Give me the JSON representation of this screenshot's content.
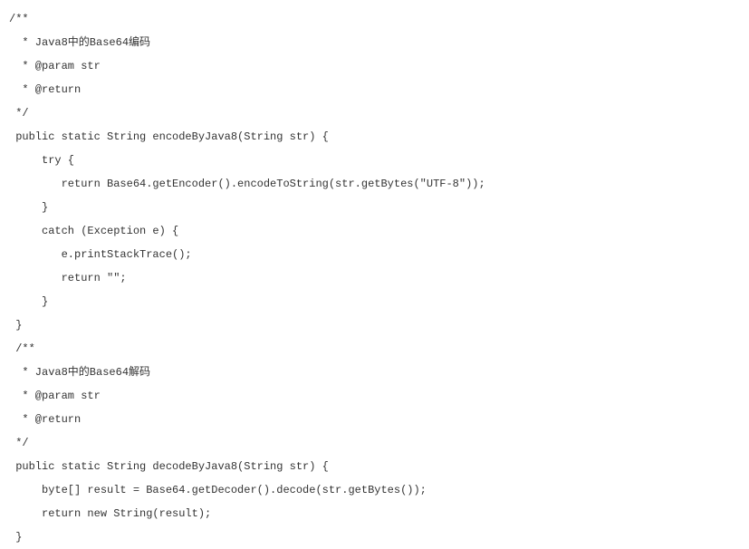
{
  "code": {
    "lines": [
      "/**",
      "  * Java8中的Base64编码",
      "  * @param str",
      "  * @return",
      " */",
      " public static String encodeByJava8(String str) {",
      "     try {",
      "        return Base64.getEncoder().encodeToString(str.getBytes(\"UTF-8\"));",
      "     }",
      "     catch (Exception e) {",
      "        e.printStackTrace();",
      "        return \"\";",
      "     }",
      " }",
      " /**",
      "  * Java8中的Base64解码",
      "  * @param str",
      "  * @return",
      " */",
      " public static String decodeByJava8(String str) {",
      "     byte[] result = Base64.getDecoder().decode(str.getBytes());",
      "     return new String(result);",
      " }"
    ]
  }
}
